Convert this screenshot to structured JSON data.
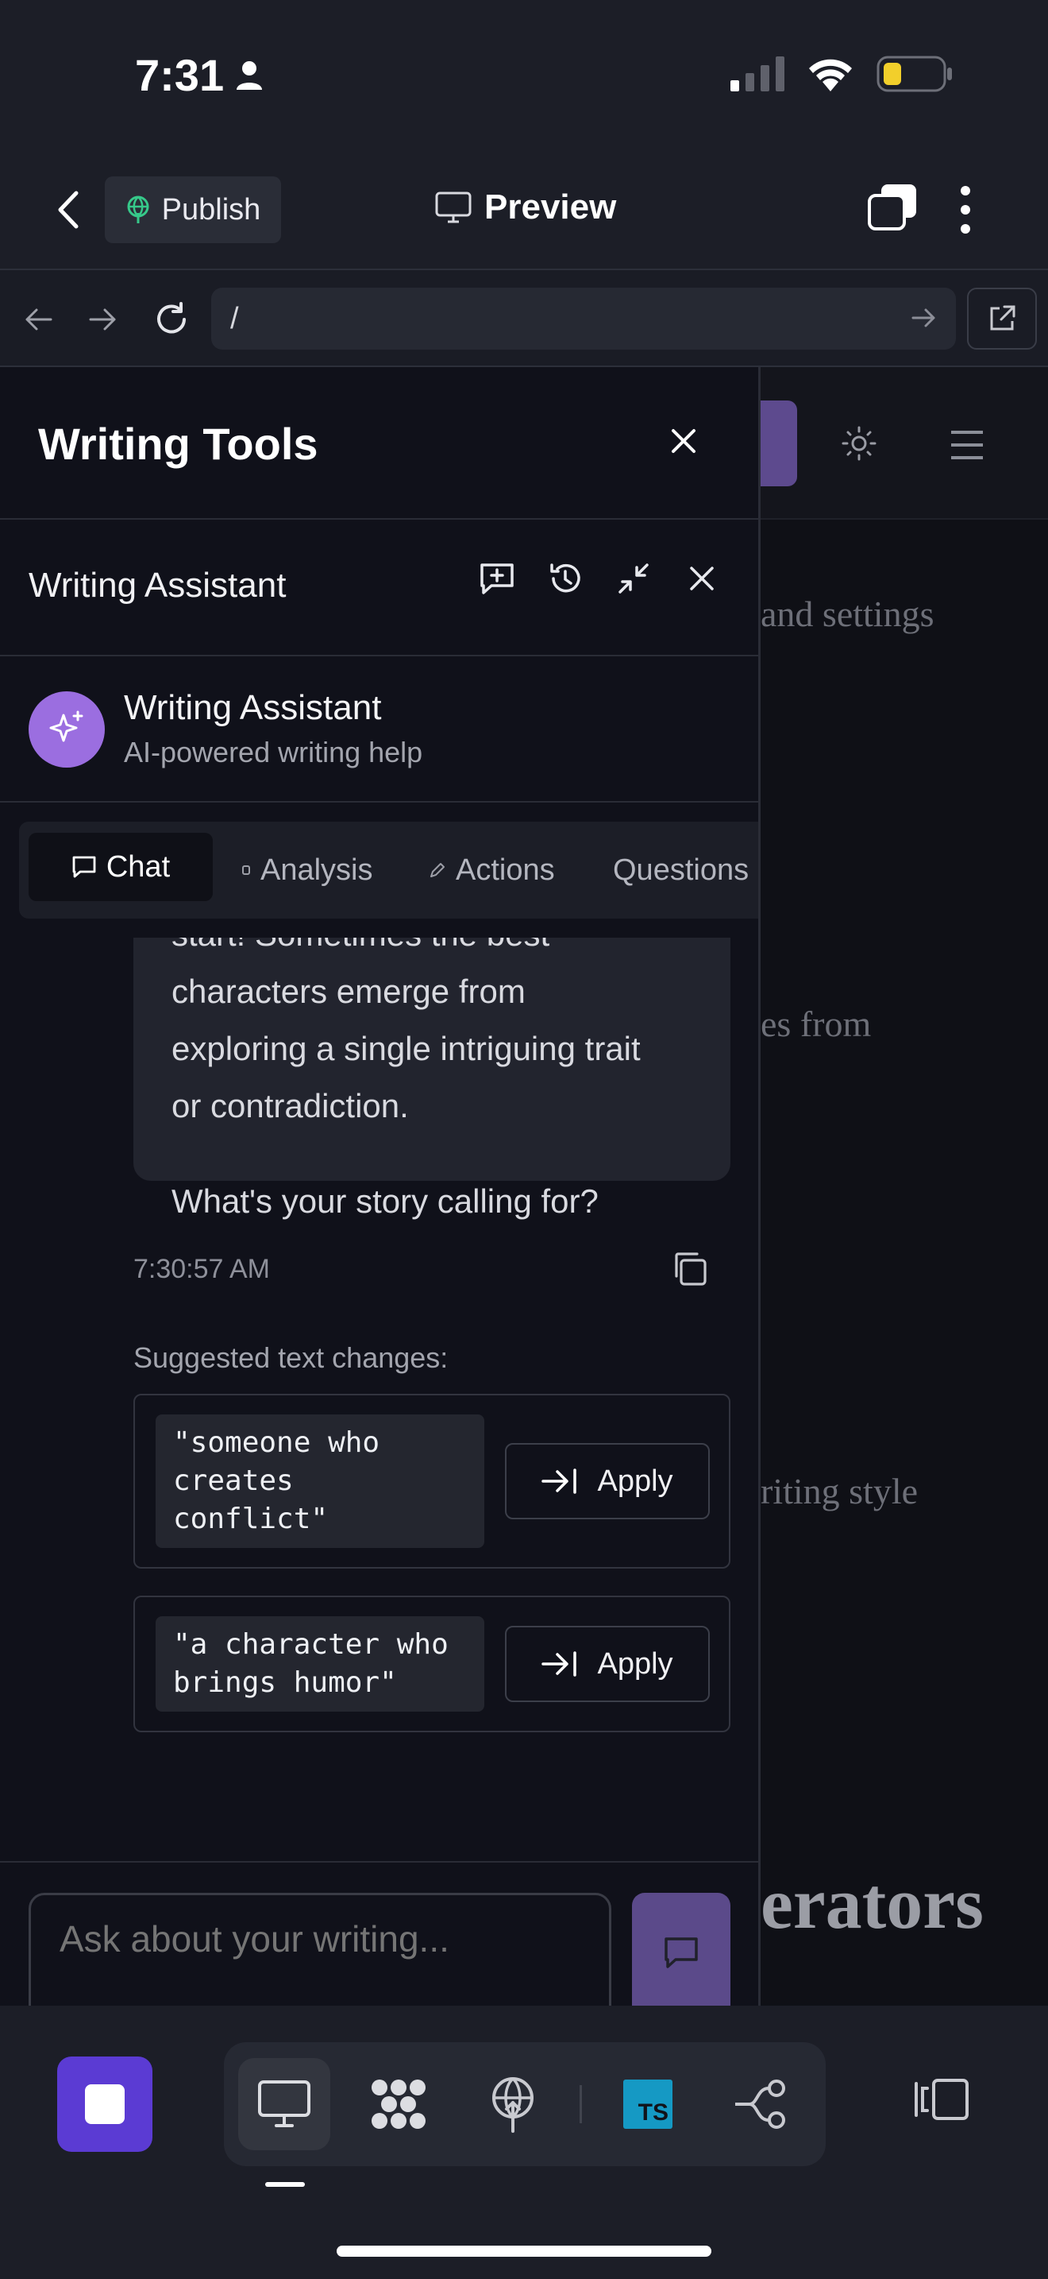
{
  "status": {
    "time": "7:31"
  },
  "header": {
    "publish_label": "Publish",
    "preview_label": "Preview"
  },
  "urlbar": {
    "url": "/"
  },
  "background_page": {
    "text_1": "and settings",
    "text_2": "es from",
    "text_3": "riting style",
    "heading": "erators"
  },
  "panel": {
    "title": "Writing Tools",
    "assistant_title": "Writing Assistant",
    "profile_name": "Writing Assistant",
    "profile_subtitle": "AI-powered writing help",
    "tabs": [
      {
        "label": "Chat",
        "icon": "chat-icon"
      },
      {
        "label": "Analysis",
        "icon": "analysis-icon"
      },
      {
        "label": "Actions",
        "icon": "pencil-icon"
      },
      {
        "label": "Questions"
      }
    ]
  },
  "chat": {
    "message_lines": [
      "start! Sometimes the best",
      "characters emerge from",
      "exploring a single intriguing trait",
      "or contradiction."
    ],
    "message_closing": "What's your story calling for?",
    "timestamp": "7:30:57 AM",
    "suggestions_title": "Suggested text changes:",
    "suggestions": [
      {
        "text": "\"someone who\ncreates\nconflict\"",
        "button": "Apply"
      },
      {
        "text": "\"a character who\nbrings humor\"",
        "button": "Apply"
      }
    ],
    "input_placeholder": "Ask about your writing..."
  },
  "toolbar": {
    "ts_label": "TS",
    "tools": [
      "desktop-icon",
      "packages-icon",
      "deploy-icon",
      "typescript-icon",
      "branch-icon"
    ]
  },
  "colors": {
    "accent": "#5b3bd3",
    "avatar": "#9b6ee0",
    "send": "#5b4a8a",
    "background": "#10111a"
  }
}
